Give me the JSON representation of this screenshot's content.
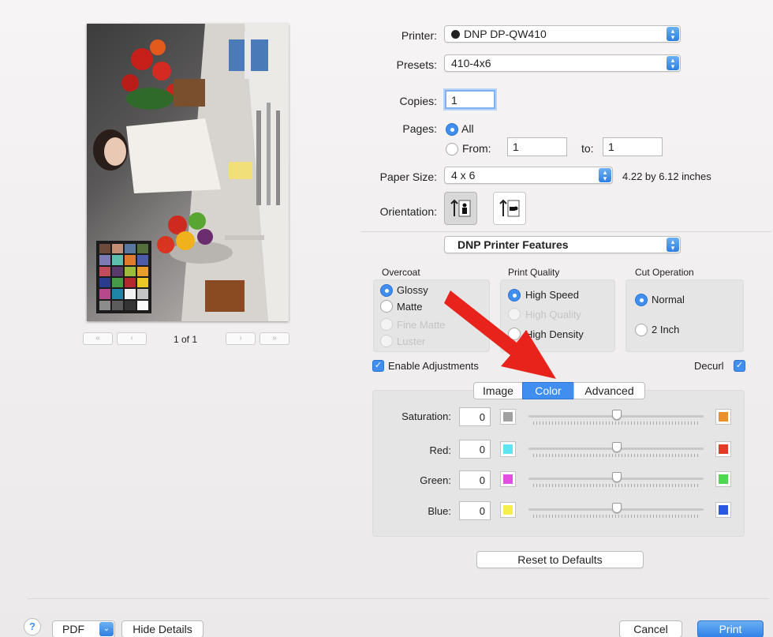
{
  "printer": {
    "label": "Printer:",
    "value": "DNP DP-QW410"
  },
  "presets": {
    "label": "Presets:",
    "value": "410-4x6"
  },
  "copies": {
    "label": "Copies:",
    "value": "1"
  },
  "pages": {
    "label": "Pages:",
    "all": "All",
    "from_label": "From:",
    "from_value": "1",
    "to_label": "to:",
    "to_value": "1"
  },
  "paper_size": {
    "label": "Paper Size:",
    "value": "4 x 6",
    "dimensions": "4.22 by 6.12 inches"
  },
  "orientation": {
    "label": "Orientation:"
  },
  "section_popup": "DNP Printer Features",
  "overcoat": {
    "title": "Overcoat",
    "options": [
      "Glossy",
      "Matte",
      "Fine Matte",
      "Luster"
    ],
    "selected": "Glossy"
  },
  "print_quality": {
    "title": "Print Quality",
    "options": [
      "High Speed",
      "High Quality",
      "High Density"
    ],
    "selected": "High Speed"
  },
  "cut_operation": {
    "title": "Cut Operation",
    "options": [
      "Normal",
      "2 Inch"
    ],
    "selected": "Normal"
  },
  "enable_adjustments": {
    "label": "Enable Adjustments",
    "checked": true
  },
  "decurl": {
    "label": "Decurl",
    "checked": true
  },
  "tabs": {
    "items": [
      "Image",
      "Color",
      "Advanced"
    ],
    "active": "Color"
  },
  "adjustments": [
    {
      "label": "Saturation:",
      "value": "0",
      "low_color": "#a0a0a0",
      "high_color": "#e8902c",
      "level": 0.5
    },
    {
      "label": "Red:",
      "value": "0",
      "low_color": "#5fe4f4",
      "high_color": "#e23c28",
      "level": 0.5
    },
    {
      "label": "Green:",
      "value": "0",
      "low_color": "#e24ee0",
      "high_color": "#4ed850",
      "level": 0.5
    },
    {
      "label": "Blue:",
      "value": "0",
      "low_color": "#f6ee4a",
      "high_color": "#2a58e0",
      "level": 0.5
    }
  ],
  "reset_button": "Reset to Defaults",
  "preview": {
    "page_indicator": "1 of 1"
  },
  "bottom": {
    "help": "?",
    "pdf": "PDF",
    "hide_details": "Hide Details",
    "cancel": "Cancel",
    "print": "Print"
  },
  "colors": {
    "accent": "#3f8ef0",
    "annotation_arrow": "#e8231c"
  }
}
